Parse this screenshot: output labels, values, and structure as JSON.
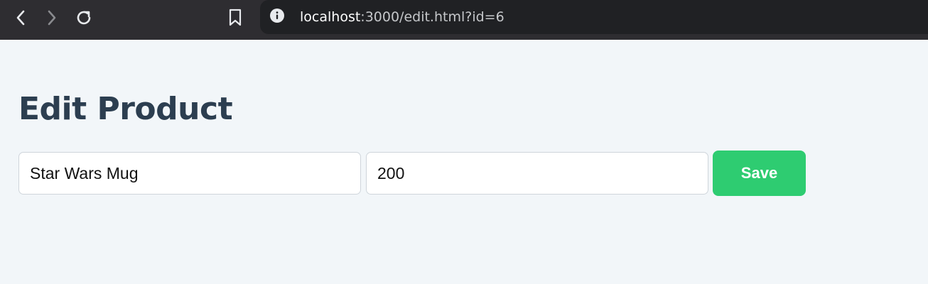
{
  "browser": {
    "url_host": "localhost",
    "url_rest": ":3000/edit.html?id=6",
    "icons": {
      "back": "chevron-left-icon",
      "forward": "chevron-right-icon",
      "reload": "reload-icon",
      "bookmark": "bookmark-icon",
      "site_info": "info-icon"
    },
    "colors": {
      "toolbar": "#2e2d31",
      "omnibox": "#202124"
    }
  },
  "page": {
    "title": "Edit Product",
    "background": "#f2f6f9",
    "title_color": "#2c3e50"
  },
  "form": {
    "name_value": "Star Wars Mug",
    "price_value": "200",
    "save_label": "Save",
    "save_color": "#2ecc71"
  }
}
